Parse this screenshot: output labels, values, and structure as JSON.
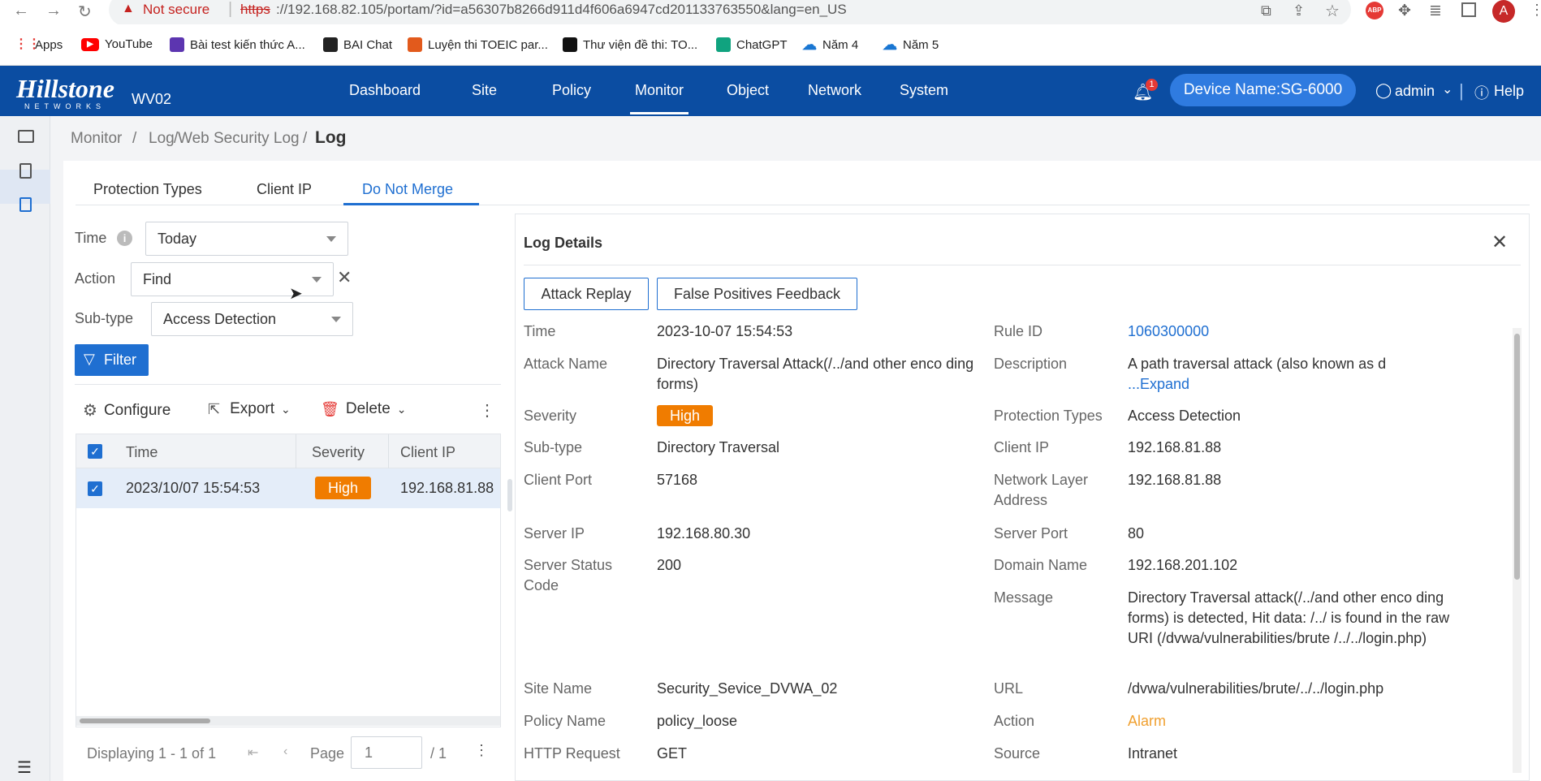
{
  "browser": {
    "not_secure": "Not secure",
    "url_scheme": "https",
    "url_rest": "://192.168.82.105/portam/?id=a56307b8266d911d4f606a6947cd201133763550&lang=en_US",
    "avatar_letter": "A"
  },
  "bookmarks": [
    {
      "label": "Apps",
      "icon": "apps-grid-icon",
      "color": "#e53935"
    },
    {
      "label": "YouTube",
      "icon": "youtube-icon",
      "color": "#ff0000"
    },
    {
      "label": "Bài test kiến thức A...",
      "icon": "list-icon",
      "color": "#5c35b0"
    },
    {
      "label": "BAI Chat",
      "icon": "bai-icon",
      "color": "#222222"
    },
    {
      "label": "Luyện thi TOEIC par...",
      "icon": "toeic-icon",
      "color": "#e25a1c"
    },
    {
      "label": "Thư viện đề thi: TO...",
      "icon": "s4-icon",
      "color": "#111111"
    },
    {
      "label": "ChatGPT",
      "icon": "chatgpt-icon",
      "color": "#10a37f"
    },
    {
      "label": "Năm 4",
      "icon": "cloud-icon",
      "color": "#1976d2"
    },
    {
      "label": "Năm 5",
      "icon": "cloud-icon",
      "color": "#1976d2"
    }
  ],
  "app": {
    "logo_main": "Hillstone",
    "logo_sub": "NETWORKS",
    "model": "WV02",
    "nav": [
      "Dashboard",
      "Site",
      "Policy",
      "Monitor",
      "Object",
      "Network",
      "System"
    ],
    "active_nav": "Monitor",
    "notification_count": "1",
    "device_name": "Device Name:SG-6000",
    "user": "admin",
    "help": "Help",
    "brand_color": "#0b4da2",
    "accent_color": "#1f6fd1"
  },
  "breadcrumb": {
    "items": [
      "Monitor",
      "Log",
      "Web Security Log"
    ],
    "current": "Log",
    "separator": "/"
  },
  "tabs": [
    "Protection Types",
    "Client IP",
    "Do Not Merge"
  ],
  "filters": {
    "time_label": "Time",
    "time_value": "Today",
    "action_label": "Action",
    "action_value": "Find",
    "subtype_label": "Sub-type",
    "subtype_value": "Access Detection",
    "filter_button": "Filter"
  },
  "toolbar": {
    "configure": "Configure",
    "export": "Export",
    "delete": "Delete"
  },
  "table": {
    "headers": [
      "Time",
      "Severity",
      "Client IP"
    ],
    "rows": [
      {
        "time": "2023/10/07 15:54:53",
        "severity": "High",
        "client_ip": "192.168.81.88"
      }
    ]
  },
  "pager": {
    "displaying": "Displaying 1 - 1 of 1",
    "page_label": "Page",
    "page_value": "1",
    "total": "/ 1"
  },
  "details": {
    "title": "Log Details",
    "attack_replay": "Attack Replay",
    "false_positive": "False Positives Feedback",
    "left": [
      {
        "key": "Time",
        "value": "2023-10-07 15:54:53"
      },
      {
        "key": "Attack Name",
        "value": "Directory Traversal Attack(/../and other enco ding forms)"
      },
      {
        "key": "Severity",
        "value": "High"
      },
      {
        "key": "Sub-type",
        "value": "Directory Traversal"
      },
      {
        "key": "Client Port",
        "value": "57168"
      },
      {
        "key": "Server IP",
        "value": "192.168.80.30"
      },
      {
        "key": "Server Status Code",
        "value": "200"
      },
      {
        "key": "Site Name",
        "value": "Security_Sevice_DVWA_02"
      },
      {
        "key": "Policy Name",
        "value": "policy_loose"
      },
      {
        "key": "HTTP Request",
        "value": "GET"
      }
    ],
    "right": [
      {
        "key": "Rule ID",
        "value": "1060300000"
      },
      {
        "key": "Description",
        "value": "A path traversal attack (also known as d",
        "expand": "...Expand"
      },
      {
        "key": "Protection Types",
        "value": "Access Detection"
      },
      {
        "key": "Client IP",
        "value": "192.168.81.88"
      },
      {
        "key": "Network Layer Address",
        "value": "192.168.81.88"
      },
      {
        "key": "Server Port",
        "value": "80"
      },
      {
        "key": "Domain Name",
        "value": "192.168.201.102"
      },
      {
        "key": "Message",
        "value": "Directory Traversal attack(/../and other enco ding forms) is detected, Hit data: /../ is found in the raw URI (/dvwa/vulnerabilities/brute /../../login.php)"
      },
      {
        "key": "URL",
        "value": "/dvwa/vulnerabilities/brute/../../login.php"
      },
      {
        "key": "Action",
        "value": "Alarm"
      },
      {
        "key": "Source",
        "value": "Intranet"
      }
    ],
    "severity_color": "#f07c00",
    "alarm_color": "#f0a030"
  }
}
